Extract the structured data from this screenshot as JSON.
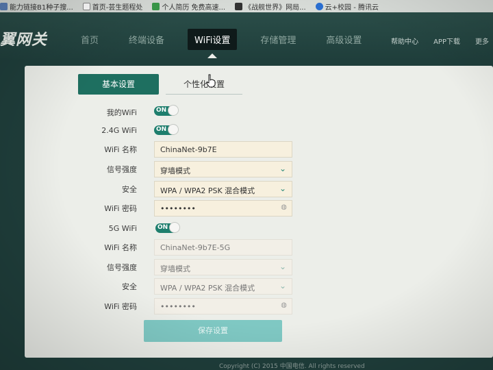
{
  "bookmarks": [
    {
      "label": "能力链接B1种子搜...",
      "icon": "page-icon",
      "color": "#5b7fb8"
    },
    {
      "label": "首页-芸生题程处",
      "icon": "page-icon",
      "color": "#8a8a8a"
    },
    {
      "label": "个人简历 免费高速...",
      "icon": "resume-icon",
      "color": "#3a9a4a"
    },
    {
      "label": "《战舰世界》网局...",
      "icon": "game-icon",
      "color": "#333333"
    },
    {
      "label": "云+校园 - 腾讯云",
      "icon": "cloud-icon",
      "color": "#2a6fd1"
    }
  ],
  "header": {
    "logo": "翼网关",
    "nav": [
      "首页",
      "终端设备",
      "WiFi设置",
      "存储管理",
      "高级设置"
    ],
    "active_nav": "WiFi设置",
    "links": [
      "帮助中心",
      "APP下载",
      "更多"
    ]
  },
  "tabs": {
    "basic": "基本设置",
    "personal": "个性化设置"
  },
  "wifi_24": {
    "my_wifi_label": "我的WiFi",
    "my_wifi_state": "ON",
    "band_label": "2.4G WiFi",
    "band_state": "ON",
    "name_label": "WiFi 名称",
    "name_value": "ChinaNet-9b7E",
    "strength_label": "信号强度",
    "strength_value": "穿墙模式",
    "security_label": "安全",
    "security_value": "WPA / WPA2 PSK 混合模式",
    "password_label": "WiFi 密码",
    "password_value": "••••••••"
  },
  "wifi_5": {
    "band_label": "5G WiFi",
    "band_state": "ON",
    "name_label": "WiFi 名称",
    "name_value": "ChinaNet-9b7E-5G",
    "strength_label": "信号强度",
    "strength_value": "穿墙模式",
    "security_label": "安全",
    "security_value": "WPA / WPA2 PSK 混合模式",
    "password_label": "WiFi 密码",
    "password_value": "••••••••"
  },
  "save_label": "保存设置",
  "footer": "Copyright (C) 2015 中国电信. All rights reserved",
  "colors": {
    "accent": "#1e6f60",
    "toggle_on": "#1e7e6d",
    "save_button": "#7fc8c3"
  }
}
